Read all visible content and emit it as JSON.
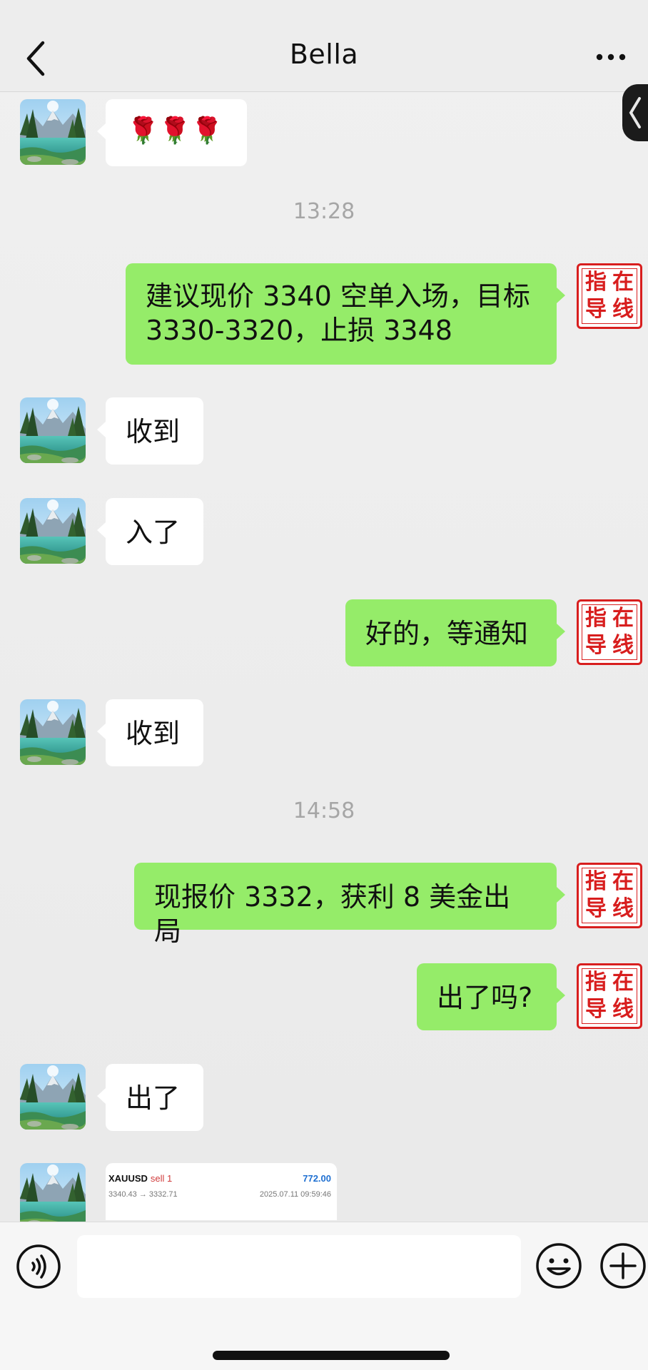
{
  "header": {
    "title": "Bella"
  },
  "messages": [
    {
      "type": "in",
      "text": "🌹🌹🌹"
    },
    {
      "type": "time",
      "text": "13:28"
    },
    {
      "type": "out",
      "text": "建议现价 3340 空单入场，目标\n3330-3320，止损 3348"
    },
    {
      "type": "in",
      "text": "收到"
    },
    {
      "type": "in",
      "text": "入了"
    },
    {
      "type": "out",
      "text": "好的，等通知"
    },
    {
      "type": "in",
      "text": "收到"
    },
    {
      "type": "time",
      "text": "14:58"
    },
    {
      "type": "out",
      "text": "现报价 3332，获利 8 美金出局"
    },
    {
      "type": "out",
      "text": "出了吗?"
    },
    {
      "type": "in",
      "text": "出了"
    }
  ],
  "stamp": {
    "chars": [
      "指",
      "在",
      "导",
      "线"
    ]
  },
  "trade_card": {
    "symbol": "XAUUSD",
    "side": "sell 1",
    "profit": "772.00",
    "prices": "3340.43 → 3332.71",
    "datetime": "2025.07.11 09:59:46"
  },
  "input_bar": {
    "placeholder": ""
  },
  "icons": {
    "back": "back-arrow-icon",
    "more": "more-dots-icon",
    "voice": "voice-icon",
    "emoji": "emoji-icon",
    "plus": "plus-icon"
  },
  "colors": {
    "bubble_out": "#95ec69",
    "bubble_in": "#ffffff",
    "stamp_red": "#d81e1e",
    "timestamp": "#a6a6a6",
    "profit_blue": "#1e6fd1",
    "sell_red": "#d03b3b"
  }
}
